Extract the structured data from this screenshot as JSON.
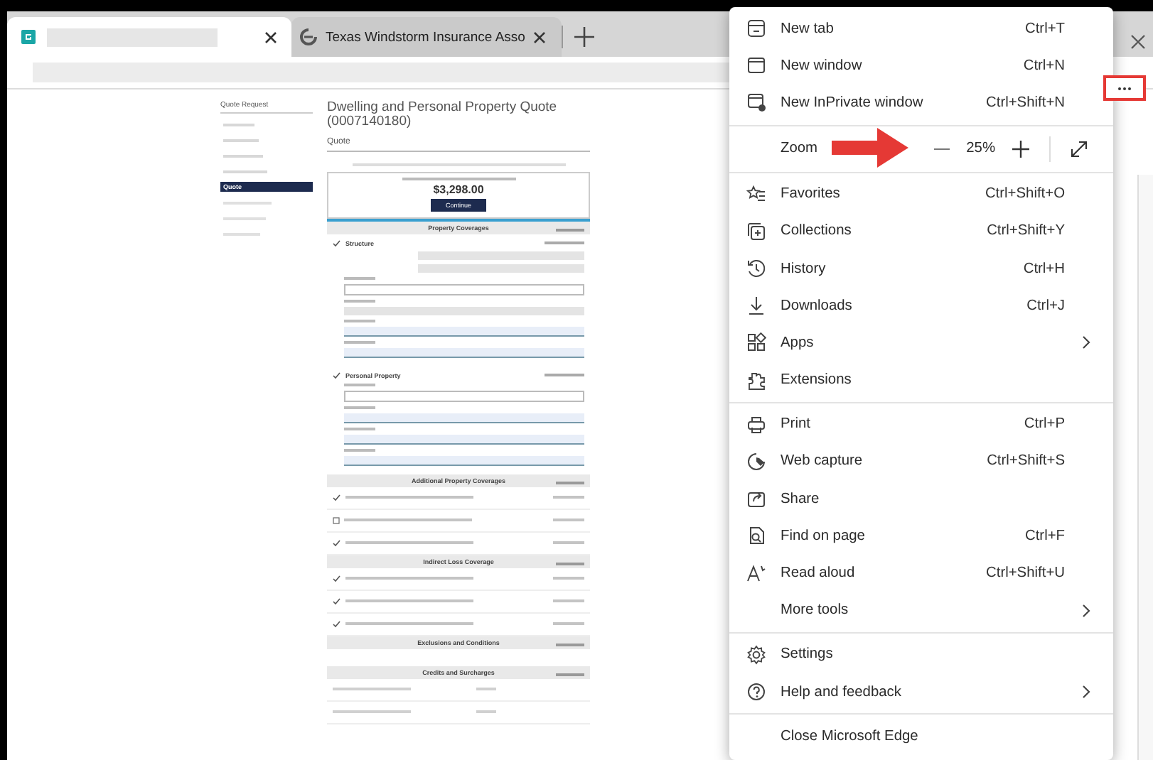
{
  "tabs": [
    {
      "selected": true
    },
    {
      "title": "Texas Windstorm Insurance Asso",
      "selected": false
    }
  ],
  "page": {
    "sidebar": {
      "heading": "Quote Request",
      "items": [
        {
          "label": "Quote",
          "selected": true
        }
      ]
    },
    "title": "Dwelling and Personal Property Quote (0007140180)",
    "subtitle": "Quote",
    "premium": {
      "amount": "$3,298.00",
      "button": "Continue"
    },
    "sections": [
      {
        "heading": "Property Coverages",
        "rows": [
          {
            "kind": "detail",
            "label": "Structure",
            "checked": true,
            "fields": [
              {
                "kind": "readonly"
              },
              {
                "kind": "readonly"
              },
              {
                "kind": "input"
              },
              {
                "kind": "select"
              },
              {
                "kind": "choice"
              },
              {
                "kind": "choice"
              }
            ]
          },
          {
            "kind": "detail",
            "label": "Personal Property",
            "checked": true,
            "fields": [
              {
                "kind": "input"
              },
              {
                "kind": "choice"
              },
              {
                "kind": "choice"
              },
              {
                "kind": "choice"
              }
            ]
          }
        ]
      },
      {
        "heading": "Additional Property Coverages",
        "rows": [
          {
            "kind": "check",
            "checked": true
          },
          {
            "kind": "check",
            "checked": false
          },
          {
            "kind": "check",
            "checked": true
          }
        ]
      },
      {
        "heading": "Indirect Loss Coverage",
        "rows": [
          {
            "kind": "check",
            "checked": true
          },
          {
            "kind": "check",
            "checked": true
          },
          {
            "kind": "check",
            "checked": true
          }
        ]
      },
      {
        "heading": "Exclusions and Conditions",
        "rows": [
          {
            "kind": "blank"
          }
        ]
      },
      {
        "heading": "Credits and Surcharges",
        "rows": [
          {
            "kind": "plain"
          },
          {
            "kind": "plain"
          }
        ]
      }
    ]
  },
  "menu": [
    {
      "kind": "item",
      "label": "New tab",
      "shortcut": "Ctrl+T"
    },
    {
      "kind": "item",
      "label": "New window",
      "shortcut": "Ctrl+N"
    },
    {
      "kind": "item",
      "label": "New InPrivate window",
      "shortcut": "Ctrl+Shift+N"
    },
    {
      "kind": "divider"
    },
    {
      "kind": "zoom",
      "label": "Zoom",
      "value": "25%"
    },
    {
      "kind": "divider"
    },
    {
      "kind": "item",
      "label": "Favorites",
      "shortcut": "Ctrl+Shift+O"
    },
    {
      "kind": "item",
      "label": "Collections",
      "shortcut": "Ctrl+Shift+Y"
    },
    {
      "kind": "item",
      "label": "History",
      "shortcut": "Ctrl+H"
    },
    {
      "kind": "item",
      "label": "Downloads",
      "shortcut": "Ctrl+J"
    },
    {
      "kind": "item",
      "label": "Apps",
      "submenu": true
    },
    {
      "kind": "item",
      "label": "Extensions"
    },
    {
      "kind": "divider"
    },
    {
      "kind": "item",
      "label": "Print",
      "shortcut": "Ctrl+P"
    },
    {
      "kind": "item",
      "label": "Web capture",
      "shortcut": "Ctrl+Shift+S"
    },
    {
      "kind": "item",
      "label": "Share"
    },
    {
      "kind": "item",
      "label": "Find on page",
      "shortcut": "Ctrl+F"
    },
    {
      "kind": "item",
      "label": "Read aloud",
      "shortcut": "Ctrl+Shift+U"
    },
    {
      "kind": "item",
      "label": "More tools",
      "submenu": true
    },
    {
      "kind": "divider"
    },
    {
      "kind": "item",
      "label": "Settings"
    },
    {
      "kind": "item",
      "label": "Help and feedback",
      "submenu": true
    },
    {
      "kind": "divider"
    },
    {
      "kind": "item",
      "label": "Close Microsoft Edge"
    }
  ]
}
